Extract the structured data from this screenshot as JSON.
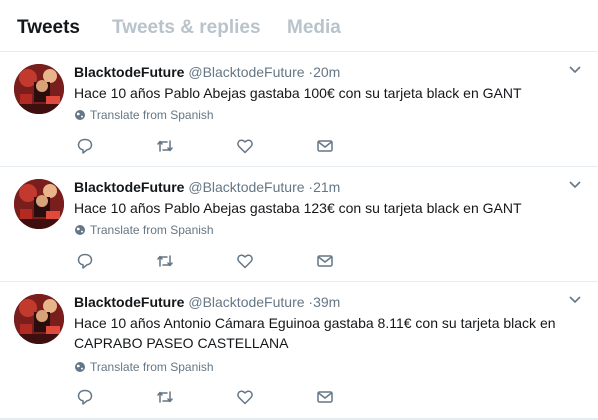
{
  "tabs": [
    {
      "label": "Tweets",
      "active": true
    },
    {
      "label": "Tweets & replies",
      "active": false
    },
    {
      "label": "Media",
      "active": false
    }
  ],
  "colors": {
    "text_primary": "#14171a",
    "text_secondary": "#657786",
    "tab_inactive": "#b8c3cb",
    "background": "#e6ecf0"
  },
  "tweets": [
    {
      "name": "BlacktodeFuture",
      "handle": "@BlacktodeFuture",
      "dot": "·",
      "time": "20m",
      "text": "Hace 10 años Pablo Abejas gastaba 100€ con su tarjeta black en GANT",
      "translate": "Translate from Spanish",
      "icons": [
        "reply-icon",
        "retweet-icon",
        "like-icon",
        "direct-message-icon"
      ]
    },
    {
      "name": "BlacktodeFuture",
      "handle": "@BlacktodeFuture",
      "dot": "·",
      "time": "21m",
      "text": "Hace 10 años Pablo Abejas gastaba 123€ con su tarjeta black en GANT",
      "translate": "Translate from Spanish",
      "icons": [
        "reply-icon",
        "retweet-icon",
        "like-icon",
        "direct-message-icon"
      ]
    },
    {
      "name": "BlacktodeFuture",
      "handle": "@BlacktodeFuture",
      "dot": "·",
      "time": "39m",
      "text": "Hace 10 años Antonio Cámara Eguinoa gastaba 8.11€ con su tarjeta black en CAPRABO PASEO CASTELLANA",
      "translate": "Translate from Spanish",
      "icons": [
        "reply-icon",
        "retweet-icon",
        "like-icon",
        "direct-message-icon"
      ]
    }
  ]
}
